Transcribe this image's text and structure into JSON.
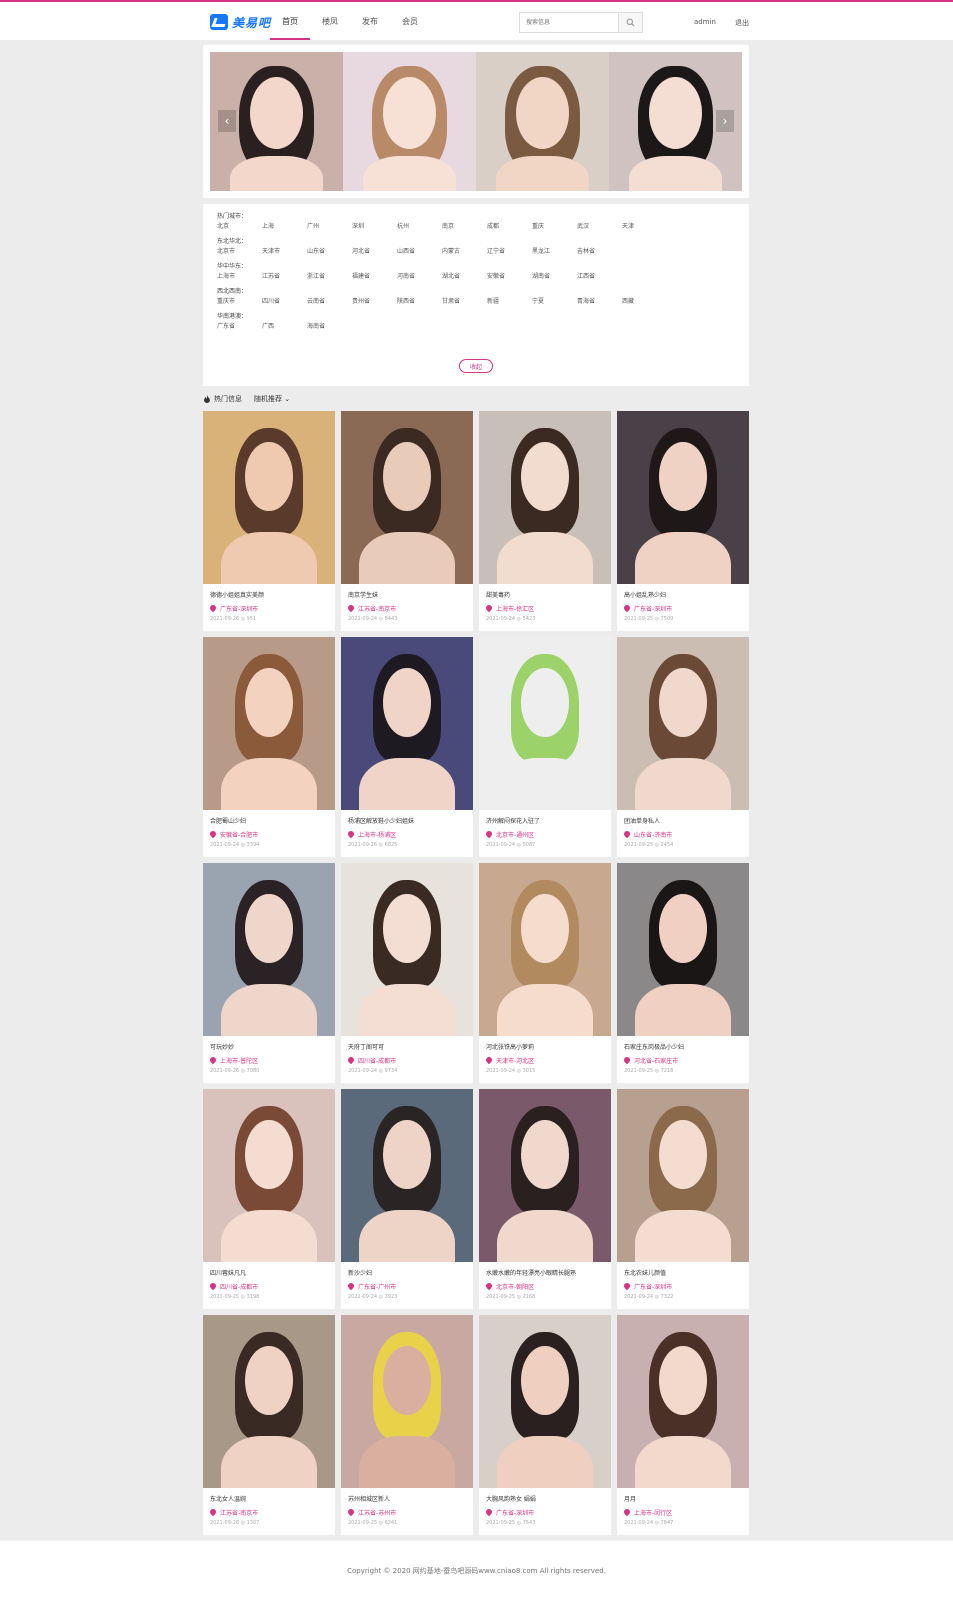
{
  "header": {
    "logo_text": "美易吧",
    "nav": [
      {
        "label": "首页",
        "active": true
      },
      {
        "label": "楼凤",
        "active": false
      },
      {
        "label": "发布",
        "active": false
      },
      {
        "label": "会员",
        "active": false
      }
    ],
    "search_placeholder": "搜索信息",
    "user": "admin",
    "logout": "退出",
    "accent": "#d63384"
  },
  "banner": {
    "slides": [
      {
        "bg": "#c9b0a8",
        "skin": "#f3d7cb",
        "hair": "#2a2020"
      },
      {
        "bg": "#e8d8e0",
        "skin": "#f7e0d6",
        "hair": "#b98a68"
      },
      {
        "bg": "#d9cfc6",
        "skin": "#f1d6c6",
        "hair": "#7a5a40"
      },
      {
        "bg": "#cfc2c0",
        "skin": "#f4ddd2",
        "hair": "#1d1818"
      }
    ]
  },
  "cities": {
    "regions": [
      {
        "title": "热门城市：",
        "cities": [
          "北京",
          "上海",
          "广州",
          "深圳",
          "杭州",
          "南京",
          "成都",
          "重庆",
          "武汉",
          "天津"
        ]
      },
      {
        "title": "东北华北：",
        "cities": [
          "北京市",
          "天津市",
          "山东省",
          "河北省",
          "山西省",
          "内蒙古",
          "辽宁省",
          "黑龙江",
          "吉林省"
        ]
      },
      {
        "title": "华中华东：",
        "cities": [
          "上海市",
          "江苏省",
          "浙江省",
          "福建省",
          "河南省",
          "湖北省",
          "安徽省",
          "湖南省",
          "江西省"
        ]
      },
      {
        "title": "西北西南：",
        "cities": [
          "重庆市",
          "四川省",
          "云南省",
          "贵州省",
          "陕西省",
          "甘肃省",
          "新疆",
          "宁夏",
          "青海省",
          "西藏"
        ]
      },
      {
        "title": "华南港澳：",
        "cities": [
          "广东省",
          "广西",
          "海南省"
        ]
      }
    ],
    "collapse_label": "收起"
  },
  "hot": {
    "label": "热门信息",
    "sort_label": "随机推荐"
  },
  "listings": [
    {
      "title": "德德小姐姐真实美颜",
      "location": "广东省-深圳市",
      "meta": "2021-09-26 ◎ 951",
      "bg": "#d9b27a",
      "skin": "#efc9b0",
      "hair": "#5a3a2a"
    },
    {
      "title": "南京学生妹",
      "location": "江苏省-南京市",
      "meta": "2021-09-24 ◎ 8443",
      "bg": "#8a6a55",
      "skin": "#e8cbb8",
      "hair": "#3a2a22"
    },
    {
      "title": "甜美毒药",
      "location": "上海市-徐汇区",
      "meta": "2021-09-24 ◎ 5423",
      "bg": "#c8c0b8",
      "skin": "#f2dccf",
      "hair": "#3b2a22"
    },
    {
      "title": "高小姐乱熟少妇",
      "location": "广东省-深圳市",
      "meta": "2021-09-25 ◎ 7509",
      "bg": "#4a4048",
      "skin": "#efd2c4",
      "hair": "#1e1818"
    },
    {
      "title": "合肥蜀山少妇",
      "location": "安徽省-合肥市",
      "meta": "2021-09-24 ◎ 3394",
      "bg": "#b89a88",
      "skin": "#f3d3bf",
      "hair": "#8a5a3a"
    },
    {
      "title": "杨浦区解放鞋小少妇姐妹",
      "location": "上海市-杨浦区",
      "meta": "2021-09-26 ◎ 6825",
      "bg": "#4a4a7a",
      "skin": "#f0d4c8",
      "hair": "#1e1a22"
    },
    {
      "title": "济州解闷探花入驻了",
      "location": "北京市-通州区",
      "meta": "2021-09-24 ◎ 5087",
      "bg": "#eeeeee",
      "skin": "#eeeeee",
      "hair": "#9bd36a"
    },
    {
      "title": "团油单身私人",
      "location": "山东省-济南市",
      "meta": "2021-09-25 ◎ 2454",
      "bg": "#cbbdb2",
      "skin": "#f1d8cc",
      "hair": "#6a4a36"
    },
    {
      "title": "可玩妙妙",
      "location": "上海市-普陀区",
      "meta": "2021-09-26 ◎ 7080",
      "bg": "#9aa4b0",
      "skin": "#efd6cb",
      "hair": "#2a2224"
    },
    {
      "title": "天府丁阁可可",
      "location": "四川省-成都市",
      "meta": "2021-09-24 ◎ 9734",
      "bg": "#e8e2dc",
      "skin": "#f4ddd2",
      "hair": "#3a2a24"
    },
    {
      "title": "河北张铁高小萝莉",
      "location": "天津市-河北区",
      "meta": "2021-09-24 ◎ 3015",
      "bg": "#c9a890",
      "skin": "#f5dccc",
      "hair": "#b28a60"
    },
    {
      "title": "石家庄东岗极品小少妇",
      "location": "河北省-石家庄市",
      "meta": "2021-09-25 ◎ 7218",
      "bg": "#8a8888",
      "skin": "#efd0c2",
      "hair": "#1a1616"
    },
    {
      "title": "四川蓉妹凡凡",
      "location": "四川省-成都市",
      "meta": "2021-09-25 ◎ 3198",
      "bg": "#d8c2bb",
      "skin": "#f5dcd0",
      "hair": "#7a4a36"
    },
    {
      "title": "新沙少妇",
      "location": "广东省-广州市",
      "meta": "2021-09-24 ◎ 3923",
      "bg": "#5a6a7a",
      "skin": "#eed4c6",
      "hair": "#2a2424"
    },
    {
      "title": "水嫩水嫩的年轻漂亮小眼睛长腿熟",
      "location": "北京市-朝阳区",
      "meta": "2021-09-25 ◎ 2168",
      "bg": "#7a5a6a",
      "skin": "#f0d8cc",
      "hair": "#2a2020"
    },
    {
      "title": "东北农妹儿颜值",
      "location": "广东省-深圳市",
      "meta": "2021-09-24 ◎ 7322",
      "bg": "#b8a090",
      "skin": "#f4dcd0",
      "hair": "#8a6a4a"
    },
    {
      "title": "东北女人温婉",
      "location": "江苏省-南京市",
      "meta": "2021-09-28 ◎ 1307",
      "bg": "#a89888",
      "skin": "#efd2c4",
      "hair": "#3a2a24"
    },
    {
      "title": "苏州相城区新人",
      "location": "江苏省-苏州市",
      "meta": "2021-09-25 ◎ 6341",
      "bg": "#c8a8a0",
      "skin": "#d9b0a0",
      "hair": "#e8d24a"
    },
    {
      "title": "大胸风韵熟女 娟娟",
      "location": "广东省-深圳市",
      "meta": "2021-09-25 ◎ 7543",
      "bg": "#d8d0c8",
      "skin": "#efd0c0",
      "hair": "#2a2020"
    },
    {
      "title": "月月",
      "location": "上海市-闵行区",
      "meta": "2021-09-24 ◎ 7847",
      "bg": "#c8b0b0",
      "skin": "#f3d8cc",
      "hair": "#4a3026"
    }
  ],
  "footer": {
    "text": "Copyright © 2020 网约基地-蚕鸟吧源码www.cniao8.com All rights reserved."
  }
}
